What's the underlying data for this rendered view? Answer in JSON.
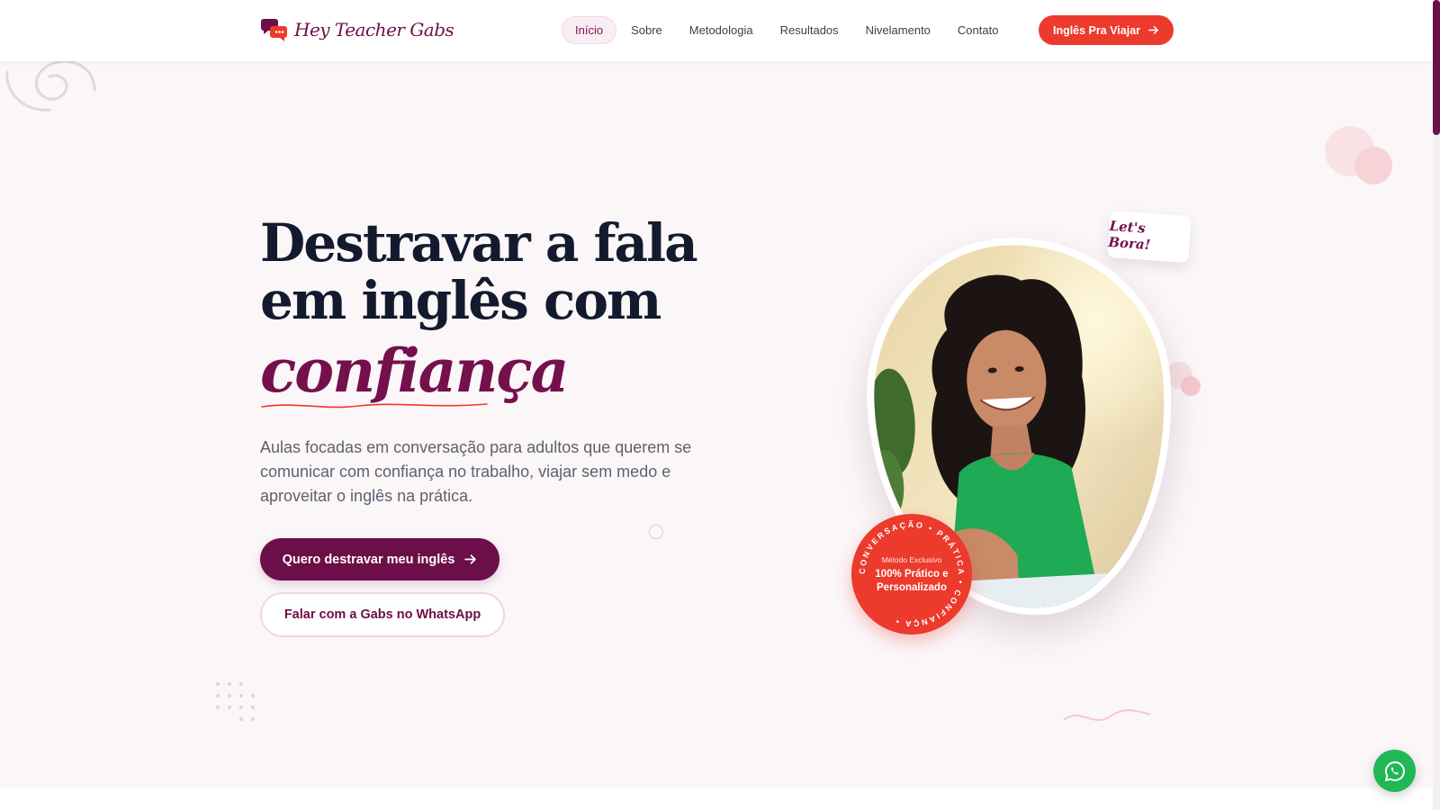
{
  "brand": {
    "name": "Hey Teacher Gabs",
    "logo_icon": "chat-bubbles-icon",
    "primary_color": "#6c0e48",
    "accent_color": "#ec3a2c"
  },
  "nav": {
    "items": [
      {
        "label": "Início",
        "active": true
      },
      {
        "label": "Sobre",
        "active": false
      },
      {
        "label": "Metodologia",
        "active": false
      },
      {
        "label": "Resultados",
        "active": false
      },
      {
        "label": "Nivelamento",
        "active": false
      },
      {
        "label": "Contato",
        "active": false
      }
    ],
    "cta_label": "Inglês Pra Viajar",
    "cta_icon": "arrow-right-icon"
  },
  "hero": {
    "title_line1": "Destravar a fala",
    "title_line2": "em inglês com",
    "script_word": "confiança",
    "subtitle": "Aulas focadas em conversação para adultos que querem se comunicar com confiança no trabalho, viajar sem medo e aproveitar o inglês na prática.",
    "primary_cta": "Quero destravar meu inglês",
    "secondary_cta": "Falar com a Gabs no WhatsApp"
  },
  "photo": {
    "sticker": "Let's Bora!",
    "badge_ring_text": "CONVERSAÇÃO • PRÁTICA • CONFIANÇA •",
    "badge_small": "Método Exclusivo",
    "badge_line1": "100% Prático e",
    "badge_line2": "Personalizado"
  },
  "whatsapp_icon": "whatsapp-icon"
}
